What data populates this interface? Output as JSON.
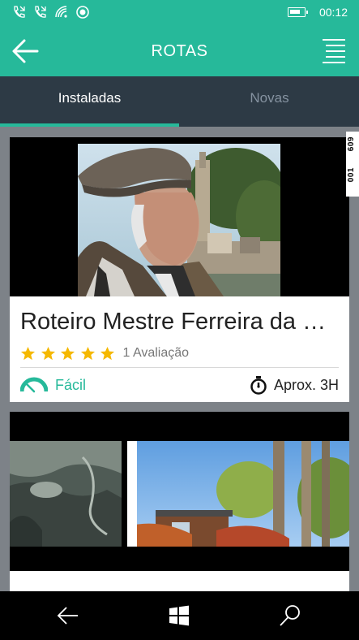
{
  "status_bar": {
    "time": "00:12",
    "icons": [
      "missed-call-icon",
      "missed-call-icon",
      "wifi-icon",
      "location-icon",
      "battery-icon"
    ]
  },
  "app_bar": {
    "title": "ROTAS",
    "back_icon": "arrow-left-icon",
    "menu_icon": "hamburger-menu-icon"
  },
  "tabs": [
    {
      "label": "Instaladas",
      "active": true
    },
    {
      "label": "Novas",
      "active": false
    }
  ],
  "side_badge": [
    "609",
    "001"
  ],
  "routes": [
    {
      "title": "Roteiro Mestre Ferreira da Silva",
      "rating": 5,
      "rating_count": "1 Avaliação",
      "difficulty": "Fácil",
      "duration": "Aprox. 3H"
    },
    {
      "title": "",
      "rating": null,
      "rating_count": "",
      "difficulty": "",
      "duration": ""
    }
  ],
  "nav_bar": {
    "icons": [
      "back-arrow-icon",
      "windows-start-icon",
      "search-icon"
    ]
  },
  "colors": {
    "accent": "#26b99a",
    "tab_bar": "#2d3a45",
    "star": "#f5b800"
  }
}
